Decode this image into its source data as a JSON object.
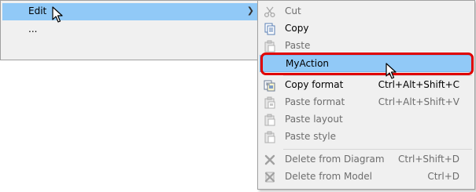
{
  "main_menu": {
    "items": [
      {
        "label": "Edit",
        "has_submenu": true,
        "highlighted": true
      },
      {
        "label": "...",
        "has_submenu": false
      }
    ]
  },
  "submenu": {
    "items": [
      {
        "label": "Cut",
        "shortcut": "",
        "enabled": false,
        "icon": "scissors-icon"
      },
      {
        "label": "Copy",
        "shortcut": "",
        "enabled": true,
        "icon": "copy-icon"
      },
      {
        "label": "Paste",
        "shortcut": "",
        "enabled": false,
        "icon": "paste-icon"
      },
      {
        "label": "MyAction",
        "shortcut": "",
        "enabled": true,
        "icon": "",
        "highlighted": true
      },
      {
        "label": "Copy format",
        "shortcut": "Ctrl+Alt+Shift+C",
        "enabled": true,
        "icon": "copy-format-icon"
      },
      {
        "label": "Paste format",
        "shortcut": "Ctrl+Alt+Shift+V",
        "enabled": false,
        "icon": "paste-format-icon"
      },
      {
        "label": "Paste layout",
        "shortcut": "",
        "enabled": false,
        "icon": "paste-layout-icon"
      },
      {
        "label": "Paste style",
        "shortcut": "",
        "enabled": false,
        "icon": "paste-style-icon"
      },
      {
        "label": "Delete from Diagram",
        "shortcut": "Ctrl+Shift+D",
        "enabled": false,
        "icon": "delete-diagram-icon"
      },
      {
        "label": "Delete from Model",
        "shortcut": "Ctrl+D",
        "enabled": false,
        "icon": "delete-model-icon"
      }
    ]
  },
  "colors": {
    "menu_bg": "#f0f0f0",
    "hover_bg": "#91c9f7",
    "callout_red": "#e00000",
    "disabled_text": "#6d6d6d"
  }
}
